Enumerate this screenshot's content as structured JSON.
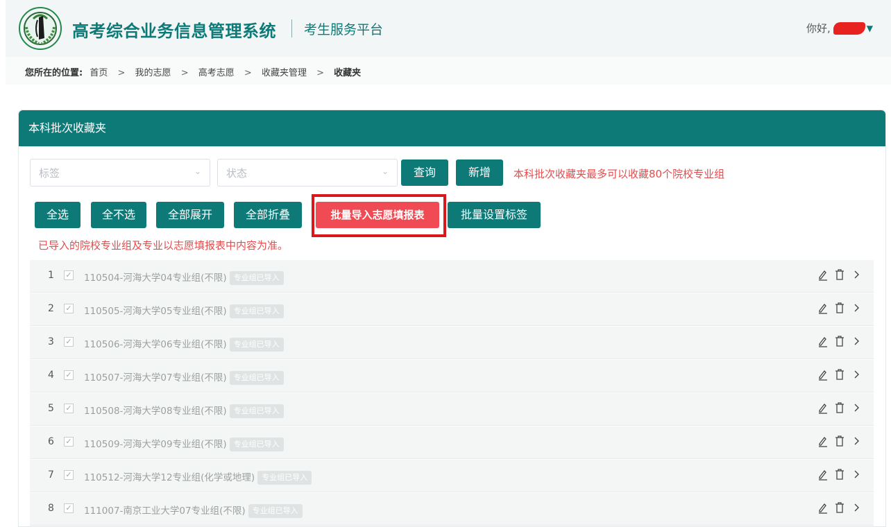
{
  "header": {
    "title": "高考综合业务信息管理系统",
    "subtitle": "考生服务平台",
    "greeting": "你好,"
  },
  "breadcrumb": {
    "lead": "您所在的位置:",
    "items": [
      "首页",
      "我的志愿",
      "高考志愿",
      "收藏夹管理",
      "收藏夹"
    ],
    "separator": ">"
  },
  "panel": {
    "title": "本科批次收藏夹",
    "filters": {
      "tag_placeholder": "标签",
      "status_placeholder": "状态"
    },
    "query_label": "查询",
    "add_label": "新增",
    "limit_note": "本科批次收藏夹最多可以收藏80个院校专业组",
    "toolbar": {
      "select_all": "全选",
      "select_none": "全不选",
      "expand_all": "全部展开",
      "collapse_all": "全部折叠",
      "batch_import": "批量导入志愿填报表",
      "batch_tag": "批量设置标签"
    },
    "import_note": "已导入的院校专业组及专业以志愿填报表中内容为准。"
  },
  "rows": [
    {
      "num": "1",
      "name": "110504-河海大学04专业组(不限)",
      "tag": "专业组已导入"
    },
    {
      "num": "2",
      "name": "110505-河海大学05专业组(不限)",
      "tag": "专业组已导入"
    },
    {
      "num": "3",
      "name": "110506-河海大学06专业组(不限)",
      "tag": "专业组已导入"
    },
    {
      "num": "4",
      "name": "110507-河海大学07专业组(不限)",
      "tag": "专业组已导入"
    },
    {
      "num": "5",
      "name": "110508-河海大学08专业组(不限)",
      "tag": "专业组已导入"
    },
    {
      "num": "6",
      "name": "110509-河海大学09专业组(不限)",
      "tag": "专业组已导入"
    },
    {
      "num": "7",
      "name": "110512-河海大学12专业组(化学或地理)",
      "tag": "专业组已导入"
    },
    {
      "num": "8",
      "name": "111007-南京工业大学07专业组(不限)",
      "tag": "专业组已导入"
    }
  ],
  "colors": {
    "brand": "#0d7a78",
    "alert": "#e24d4d",
    "highlight_box": "#d7191c"
  }
}
